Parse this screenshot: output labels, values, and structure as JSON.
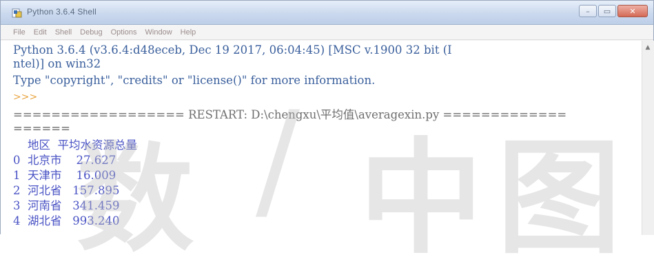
{
  "window": {
    "title": "Python 3.6.4 Shell"
  },
  "menubar": {
    "items": [
      "File",
      "Edit",
      "Shell",
      "Debug",
      "Options",
      "Window",
      "Help"
    ]
  },
  "shell": {
    "banner_line1": "Python 3.6.4 (v3.6.4:d48eceb, Dec 19 2017, 06:04:45) [MSC v.1900 32 bit (I",
    "banner_line2": "ntel)] on win32",
    "banner_line3": "Type \"copyright\", \"credits\" or \"license()\" for more information.",
    "prompt": ">>>",
    "restart_line": "================== RESTART: D:\\chengxu\\平均值\\averagexin.py =============",
    "restart_cont": "======",
    "table_header": "    地区  平均水资源总量",
    "rows": [
      "0  北京市    27.627",
      "1  天津市    16.009",
      "2  河北省   157.895",
      "3  河南省   341.459",
      "4  湖北省   993.240"
    ]
  },
  "watermark": {
    "chars": [
      "数",
      "/",
      "中",
      "图"
    ]
  },
  "colors": {
    "output_blue": "#3a5f9c",
    "prompt_orange": "#e8a13a",
    "table_purple": "#4a53c4"
  }
}
